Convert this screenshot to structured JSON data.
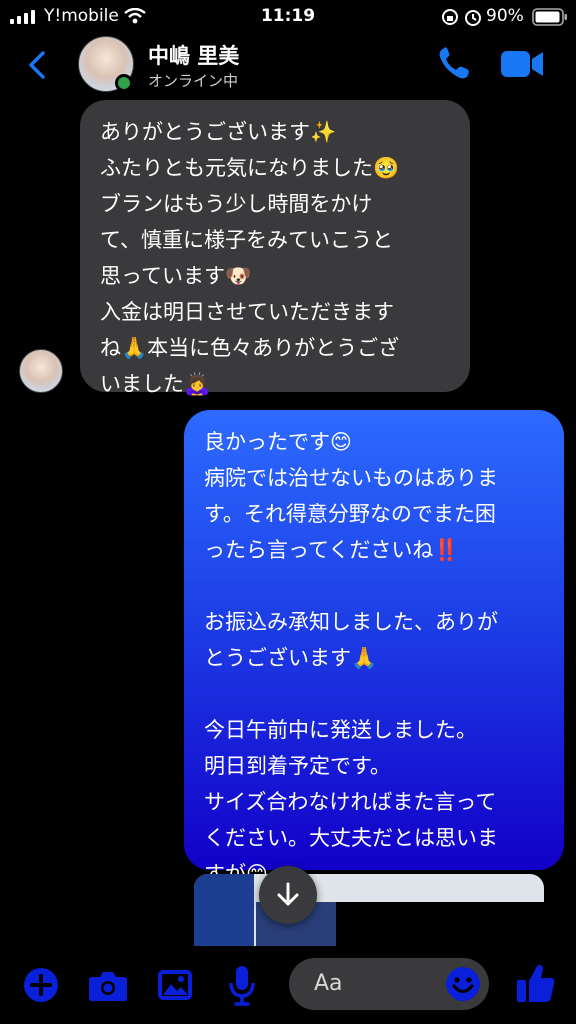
{
  "status_bar": {
    "carrier": "Y!mobile",
    "time": "11:19",
    "battery": "90%"
  },
  "header": {
    "contact_name": "中嶋 里美",
    "presence": "オンライン中"
  },
  "messages": [
    {
      "direction": "incoming",
      "text": "ありがとうございます✨\nふたりとも元気になりました🥹\nブランはもう少し時間をかけ\nて、慎重に様子をみていこうと\n思っています🐶\n入金は明日させていただきます\nね🙏本当に色々ありがとうござ\nいました🙇‍♀️"
    },
    {
      "direction": "outgoing",
      "text": "良かったです😊\n病院では治せないものはありま\nす。それ得意分野なのでまた困\nったら言ってくださいね‼️\n\nお振込み承知しました、ありが\nとうございます🙏\n\n今日午前中に発送しました。\n明日到着予定です。\nサイズ合わなければまた言って\nください。大丈夫だとは思いま\nすが😊"
    }
  ],
  "composer": {
    "placeholder": "Aa"
  },
  "colors": {
    "accent": "#1877f2",
    "composer_icon": "#0a1fd8",
    "incoming_bubble": "#3a3a3c",
    "outgoing_top": "#2d6bff",
    "outgoing_bottom": "#1200c8"
  },
  "icons": [
    "signal-icon",
    "wifi-icon",
    "lock-rotation-icon",
    "alarm-icon",
    "battery-icon",
    "back-chevron-icon",
    "phone-icon",
    "video-icon",
    "arrow-down-icon",
    "plus-icon",
    "camera-icon",
    "gallery-icon",
    "mic-icon",
    "emoji-icon",
    "thumbs-up-icon"
  ]
}
